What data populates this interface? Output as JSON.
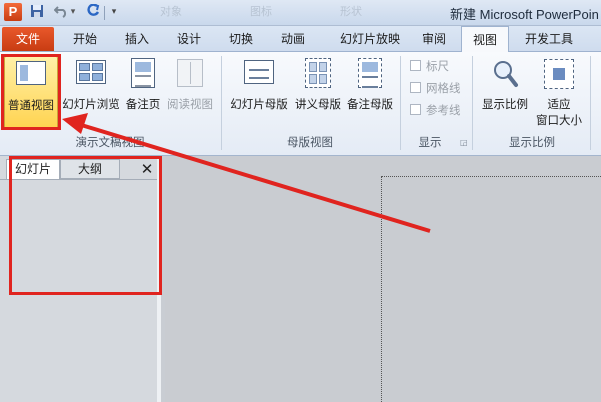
{
  "title_bar": {
    "app_icon_letter": "P",
    "window_title": "新建 Microsoft PowerPoin",
    "ghost_items": [
      "对象",
      "图标",
      "形状"
    ],
    "qa_undo_dropdown_glyph": "▾",
    "qa_customize_glyph": "▾"
  },
  "tabs": {
    "file": "文件",
    "home": "开始",
    "insert": "插入",
    "design": "设计",
    "transitions": "切换",
    "animations": "动画",
    "slideshow": "幻灯片放映",
    "review": "审阅",
    "view": "视图",
    "developer": "开发工具"
  },
  "ribbon": {
    "presentation_views": {
      "normal": "普通视图",
      "slide_sorter": "幻灯片浏览",
      "notes_page": "备注页",
      "reading_view": "阅读视图",
      "group_label": "演示文稿视图"
    },
    "master_views": {
      "slide_master": "幻灯片母版",
      "handout_master": "讲义母版",
      "notes_master": "备注母版",
      "group_label": "母版视图"
    },
    "show": {
      "ruler": "标尺",
      "gridlines": "网格线",
      "guides": "参考线",
      "group_label": "显示"
    },
    "zoom": {
      "zoom": "显示比例",
      "fit_line1": "适应",
      "fit_line2": "窗口大小",
      "group_label": "显示比例"
    }
  },
  "left_pane": {
    "tab_slides": "幻灯片",
    "tab_outline": "大纲",
    "close_glyph": "✕"
  },
  "colors": {
    "annotation_red": "#e0241f",
    "file_tab": "#d4481c",
    "selected_button": "#ffd34f"
  }
}
